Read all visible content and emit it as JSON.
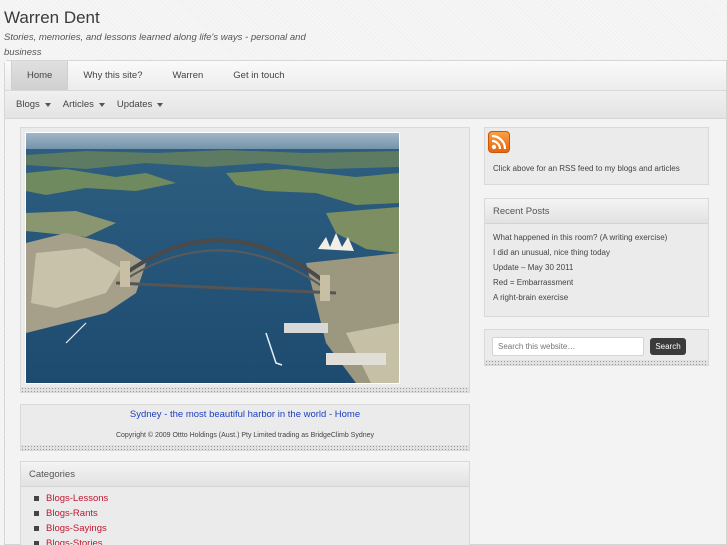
{
  "site": {
    "title": "Warren Dent",
    "tagline": "Stories, memories, and lessons learned along life's ways - personal and business"
  },
  "main_nav": [
    {
      "label": "Home",
      "active": true
    },
    {
      "label": "Why this site?",
      "active": false
    },
    {
      "label": "Warren",
      "active": false
    },
    {
      "label": "Get in touch",
      "active": false
    }
  ],
  "sub_nav": [
    {
      "label": "Blogs"
    },
    {
      "label": "Articles"
    },
    {
      "label": "Updates"
    }
  ],
  "featured": {
    "caption_link": "Sydney - the most beautiful harbor in the world - Home",
    "copyright": "Copyright © 2009 Ottto Holdings (Aust.) Pty Limited trading as BridgeClimb Sydney"
  },
  "categories": {
    "heading": "Categories",
    "items": [
      "Blogs-Lessons",
      "Blogs-Rants",
      "Blogs-Sayings",
      "Blogs-Stories"
    ]
  },
  "rss": {
    "icon": "rss-feed-icon",
    "text": "Click above for an RSS feed to my blogs and articles"
  },
  "recent_posts": {
    "heading": "Recent Posts",
    "items": [
      "What happened in this room? (A writing exercise)",
      "I did an unusual, nice thing today",
      "Update – May 30 2011",
      "Red = Embarrassment",
      "A right-brain exercise"
    ]
  },
  "search": {
    "placeholder": "Search this website…",
    "button_label": "Search"
  },
  "colors": {
    "link_blue": "#1a3ec0",
    "category_red": "#c0172f",
    "rss_orange": "#f07c1e",
    "search_button": "#3b3b3b"
  }
}
